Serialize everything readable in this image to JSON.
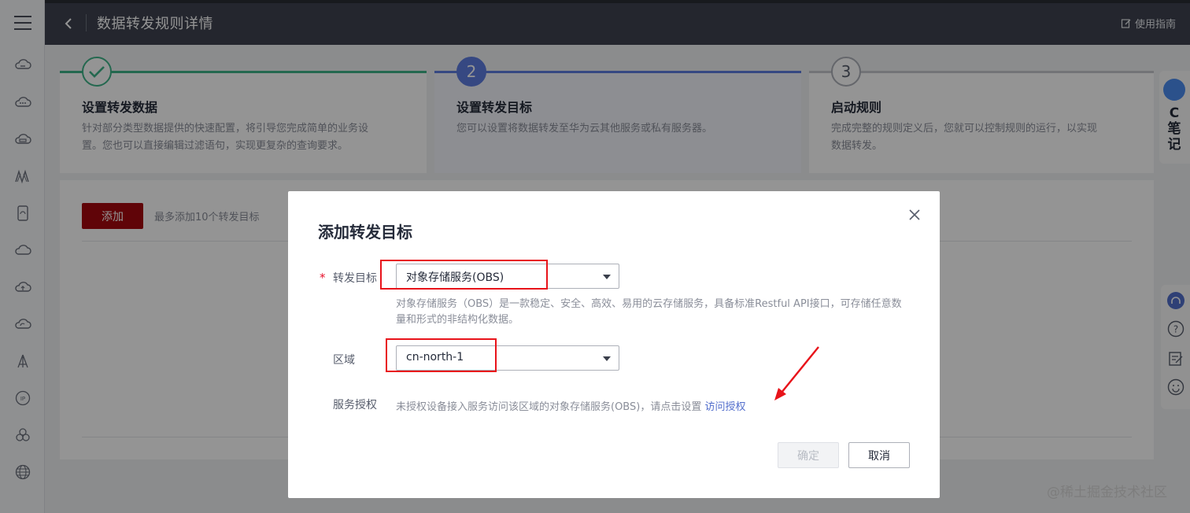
{
  "header": {
    "title": "数据转发规则详情",
    "guide_label": "使用指南"
  },
  "sidebar": {
    "icons": [
      "cloud-icon",
      "cloud-dots-icon",
      "cloud-storage-icon",
      "signal-icon",
      "device-icon",
      "cloud-outline-icon",
      "cloud-upload-icon",
      "cloud-sync-icon",
      "broadcast-icon",
      "ip-icon",
      "cluster-icon",
      "globe-icon"
    ]
  },
  "steps": [
    {
      "number": "",
      "title": "设置转发数据",
      "desc": "针对部分类型数据提供的快速配置，将引导您完成简单的业务设置。您也可以直接编辑过滤语句，实现更复杂的查询要求。",
      "state": "done"
    },
    {
      "number": "2",
      "title": "设置转发目标",
      "desc": "您可以设置将数据转发至华为云其他服务或私有服务器。",
      "state": "active"
    },
    {
      "number": "3",
      "title": "启动规则",
      "desc": "完成完整的规则定义后，您就可以控制规则的运行，以实现数据转发。",
      "state": "pending"
    }
  ],
  "panel": {
    "add_label": "添加",
    "hint": "最多添加10个转发目标"
  },
  "side_notes": {
    "text_c": "C",
    "text_1": "笔",
    "text_2": "记"
  },
  "watermark": "@稀土掘金技术社区",
  "dialog": {
    "title": "添加转发目标",
    "required_mark": "*",
    "target_label": "转发目标",
    "target_value": "对象存储服务(OBS)",
    "target_desc": "对象存储服务（OBS）是一款稳定、安全、高效、易用的云存储服务，具备标准Restful API接口，可存储任意数量和形式的非结构化数据。",
    "region_label": "区域",
    "region_value": "cn-north-1",
    "auth_label": "服务授权",
    "auth_text": "未授权设备接入服务访问该区域的对象存储服务(OBS)，请点击设置 ",
    "auth_link": "访问授权",
    "ok_label": "确定",
    "cancel_label": "取消"
  },
  "colors": {
    "brand_red": "#a6080e",
    "step_done": "#3eb489",
    "step_active": "#5e7ce0",
    "annotation_red": "#e8131a",
    "link": "#526ecc"
  }
}
